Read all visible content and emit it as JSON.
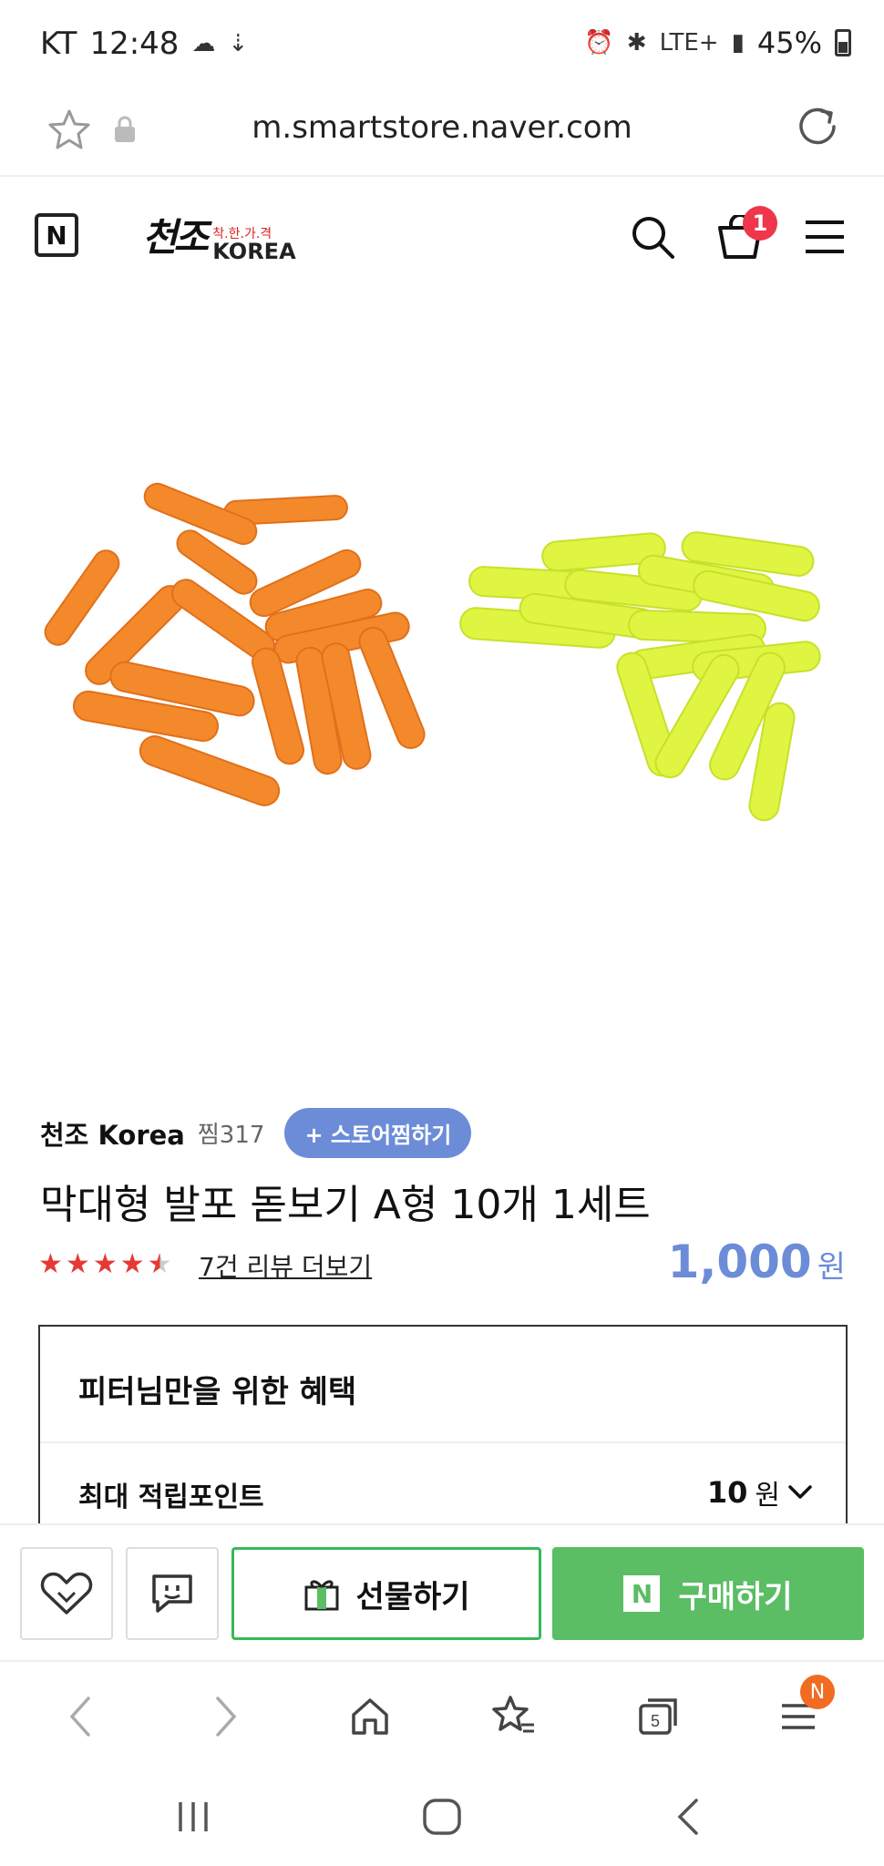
{
  "status_bar": {
    "carrier": "KT",
    "time": "12:48",
    "network": "LTE+",
    "battery": "45%"
  },
  "url_bar": {
    "url": "m.smartstore.naver.com"
  },
  "header": {
    "naver_logo": "N",
    "store_logo_main": "천조",
    "store_logo_tag": "착.한.가.격",
    "store_logo_en": "KOREA",
    "cart_count": "1",
    "icons": [
      "search-icon",
      "cart-icon",
      "menu-icon"
    ]
  },
  "product": {
    "store_name": "천조 Korea",
    "jjim_count": "찜317",
    "store_follow_button": "+ 스토어찜하기",
    "title": "막대형 발포 돋보기 A형 10개 1세트",
    "rating": 4.5,
    "review_link": "7건 리뷰 더보기",
    "price": "1,000",
    "currency": "원"
  },
  "benefit": {
    "title": "피터님만을 위한 혜택",
    "point_label": "최대 적립포인트",
    "point_value": "10",
    "point_unit": "원"
  },
  "action_bar": {
    "gift_label": "선물하기",
    "buy_label": "구매하기",
    "buy_badge": "N"
  },
  "browser_nav": {
    "tabs_count": "5",
    "menu_badge": "N"
  },
  "colors": {
    "accent_blue": "#6c8cd8",
    "buy_green": "#5bbd64",
    "badge_red": "#f0364a",
    "star_red": "#e53935"
  }
}
